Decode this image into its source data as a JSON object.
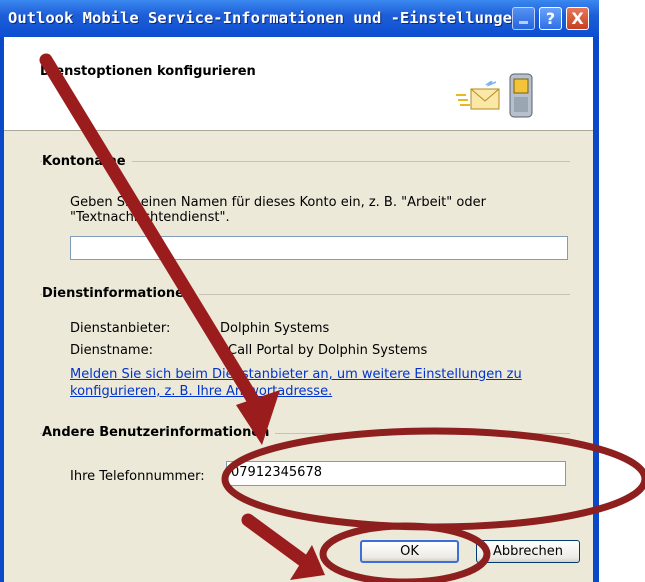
{
  "window": {
    "title": "Outlook Mobile Service-Informationen und -Einstellungen",
    "help_glyph": "?",
    "close_glyph": "X"
  },
  "header": {
    "heading": "Dienstoptionen konfigurieren",
    "icons": [
      "mail-envelope-icon",
      "mobile-phone-icon"
    ]
  },
  "account": {
    "section_title": "Kontoname",
    "description_line1": "Geben Sie einen Namen für dieses Konto ein, z. B. \"Arbeit\" oder",
    "description_line2": "\"Textnachrichtendienst\".",
    "name_value": ""
  },
  "service": {
    "section_title": "Dienstinformationen",
    "provider_label": "Dienstanbieter:",
    "provider_value": "Dolphin Systems",
    "name_label": "Dienstname:",
    "name_value": "eCall Portal by Dolphin Systems",
    "link_line1": "Melden Sie sich beim Dienstanbieter an, um weitere Einstellungen zu",
    "link_line2": "konfigurieren, z. B. Ihre Antwortadresse."
  },
  "other": {
    "section_title": "Andere Benutzerinformationen",
    "phone_label": "Ihre Telefonnummer:",
    "phone_value": "07912345678"
  },
  "buttons": {
    "ok": "OK",
    "cancel": "Abbrechen"
  },
  "annotations": {
    "arrow_color": "#9b1c1c",
    "ellipse_color": "#8e1f1f"
  },
  "colors": {
    "titlebar": "#0b4ed0",
    "dialog_bg": "#ece9d8",
    "link": "#0033cc"
  }
}
